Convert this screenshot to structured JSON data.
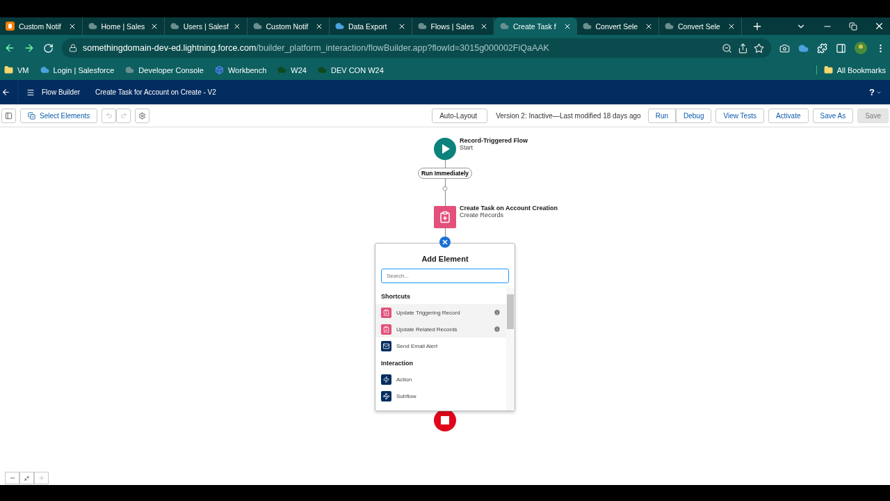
{
  "browser": {
    "tabs": [
      {
        "title": "Custom Notif",
        "kind": "blogger",
        "selected": false
      },
      {
        "title": "Home | Sales",
        "kind": "cloud-grey",
        "selected": false
      },
      {
        "title": "Users | Salesf",
        "kind": "cloud-grey",
        "selected": false
      },
      {
        "title": "Custom Notif",
        "kind": "cloud-grey",
        "selected": false
      },
      {
        "title": "Data Export",
        "kind": "cloud-blue",
        "selected": false
      },
      {
        "title": "Flows | Sales",
        "kind": "cloud-grey",
        "selected": false
      },
      {
        "title": "Create Task f",
        "kind": "cloud-grey",
        "selected": true
      },
      {
        "title": "Convert Sele",
        "kind": "cloud-grey",
        "selected": false
      },
      {
        "title": "Convert Sele",
        "kind": "cloud-grey",
        "selected": false
      }
    ],
    "url": {
      "domain": "somethingdomain-dev-ed.lightning.force.com",
      "path": "/builder_platform_interaction/flowBuilder.app?flowId=3015g000002FiQaAAK"
    },
    "bookmarks": [
      {
        "label": "VM",
        "kind": "folder"
      },
      {
        "label": "Login | Salesforce",
        "kind": "cloud-blue"
      },
      {
        "label": "Developer Console",
        "kind": "cloud-grey"
      },
      {
        "label": "Workbench",
        "kind": "cube"
      },
      {
        "label": "W24",
        "kind": "cloud-green"
      },
      {
        "label": "DEV CON W24",
        "kind": "cloud-green"
      }
    ],
    "all_bookmarks": "All Bookmarks"
  },
  "app": {
    "name": "Flow Builder",
    "flow_title": "Create Task for Account on Create - V2",
    "help": "?"
  },
  "toolbar": {
    "select_elements": "Select Elements",
    "layout": "Auto-Layout",
    "status": "Version 2: Inactive—Last modified 18 days ago",
    "buttons": [
      {
        "label": "Run",
        "disabled": false
      },
      {
        "label": "Debug",
        "disabled": false
      },
      {
        "label": "View Tests",
        "disabled": false
      },
      {
        "label": "Activate",
        "disabled": false
      },
      {
        "label": "Save As",
        "disabled": false
      },
      {
        "label": "Save",
        "disabled": true
      }
    ]
  },
  "canvas": {
    "start": {
      "title": "Record-Triggered Flow",
      "subtitle": "Start"
    },
    "trigger": "Run Immediately",
    "element": {
      "title": "Create Task on Account Creation",
      "subtitle": "Create Records"
    }
  },
  "add_element": {
    "title": "Add Element",
    "search": {
      "placeholder": "Search..."
    },
    "sections": [
      {
        "heading": "Shortcuts",
        "items": [
          {
            "label": "Update Triggering Record",
            "kind": "update",
            "highlighted": true,
            "info": true
          },
          {
            "label": "Update Related Records",
            "kind": "update",
            "highlighted": true,
            "info": true
          },
          {
            "label": "Send Email Alert",
            "kind": "email",
            "highlighted": false,
            "info": false
          }
        ]
      },
      {
        "heading": "Interaction",
        "items": [
          {
            "label": "Action",
            "kind": "action",
            "highlighted": false,
            "info": false
          },
          {
            "label": "Subflow",
            "kind": "subflow",
            "highlighted": false,
            "info": false
          }
        ]
      }
    ]
  }
}
